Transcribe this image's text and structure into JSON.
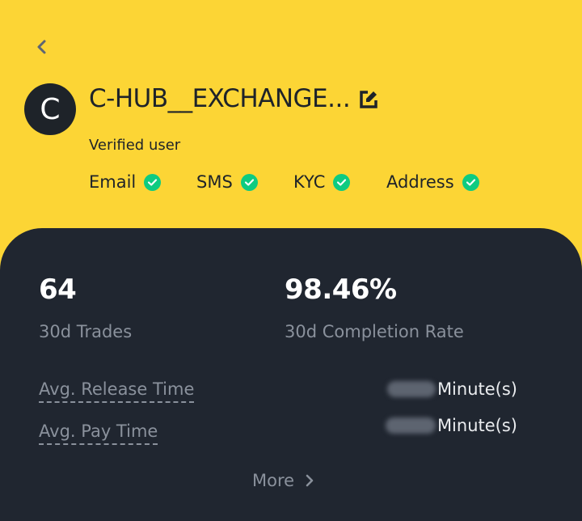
{
  "profile": {
    "avatar_letter": "C",
    "nickname": "C-HUB__EXCHANGE...",
    "status": "Verified user"
  },
  "verifications": [
    {
      "label": "Email",
      "verified": true
    },
    {
      "label": "SMS",
      "verified": true
    },
    {
      "label": "KYC",
      "verified": true
    },
    {
      "label": "Address",
      "verified": true
    }
  ],
  "stats": {
    "trades_value": "64",
    "trades_label": "30d Trades",
    "completion_value": "98.46%",
    "completion_label": "30d Completion Rate"
  },
  "metrics": {
    "release_label": "Avg. Release Time",
    "release_value": "Minute(s)",
    "pay_label": "Avg. Pay Time",
    "pay_value": "Minute(s)"
  },
  "more_label": "More",
  "colors": {
    "header_bg": "#fcd535",
    "panel_bg": "#202630",
    "check": "#0ecb81",
    "muted_text": "#8a919c"
  },
  "icons": {
    "back": "chevron-left-icon",
    "edit": "edit-icon",
    "check": "check-circle-icon",
    "more": "chevron-right-icon"
  }
}
